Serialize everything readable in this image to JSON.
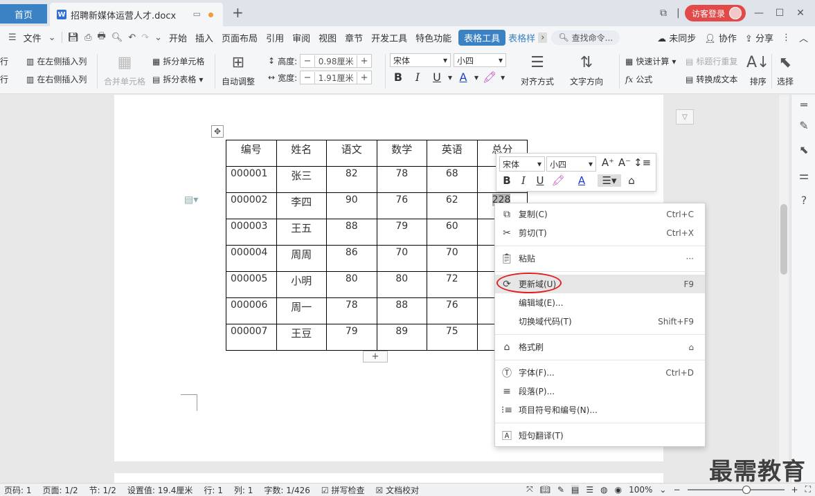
{
  "tabs": {
    "home": "首页",
    "doc_title": "招聘新媒体运营人才.docx",
    "new": "+"
  },
  "titlebar": {
    "login": "访客登录"
  },
  "menu": {
    "file": "文件",
    "items": [
      "开始",
      "插入",
      "页面布局",
      "引用",
      "审阅",
      "视图",
      "章节",
      "开发工具",
      "特色功能"
    ],
    "table_tools": "表格工具",
    "table_style": "表格样",
    "search": "查找命令...",
    "unsync": "未同步",
    "collab": "协作",
    "share": "分享"
  },
  "ribbon": {
    "insert_row_above_partial": "行",
    "insert_row_below_partial": "行",
    "insert_col_left": "在左侧插入列",
    "insert_col_right": "在右侧插入列",
    "merge_cells": "合并单元格",
    "split_cells": "拆分单元格",
    "split_table": "拆分表格",
    "auto_fit": "自动调整",
    "height_label": "高度:",
    "height_value": "0.98厘米",
    "width_label": "宽度:",
    "width_value": "1.91厘米",
    "font_name": "宋体",
    "font_size": "小四",
    "align": "对齐方式",
    "text_dir": "文字方向",
    "quick_calc": "快速计算",
    "repeat_header": "标题行重复",
    "formula": "公式",
    "to_text": "转换成文本",
    "sort": "排序",
    "select": "选择"
  },
  "table": {
    "headers": [
      "编号",
      "姓名",
      "语文",
      "数学",
      "英语",
      "总分"
    ],
    "rows": [
      [
        "000001",
        "张三",
        "82",
        "78",
        "68",
        "2"
      ],
      [
        "000002",
        "李四",
        "90",
        "76",
        "62",
        ""
      ],
      [
        "000003",
        "王五",
        "88",
        "79",
        "60",
        ""
      ],
      [
        "000004",
        "周周",
        "86",
        "70",
        "70",
        ""
      ],
      [
        "000005",
        "小明",
        "80",
        "80",
        "72",
        ""
      ],
      [
        "000006",
        "周一",
        "78",
        "88",
        "76",
        ""
      ],
      [
        "000007",
        "王豆",
        "79",
        "89",
        "75",
        ""
      ]
    ],
    "selected_value": "228",
    "add_row": "+"
  },
  "mini_toolbar": {
    "font": "宋体",
    "size": "小四"
  },
  "context_menu": {
    "copy": "复制(C)",
    "copy_sc": "Ctrl+C",
    "cut": "剪切(T)",
    "cut_sc": "Ctrl+X",
    "paste": "粘贴",
    "paste_more": "···",
    "update_field": "更新域(U)",
    "update_field_sc": "F9",
    "edit_field": "编辑域(E)...",
    "toggle_code": "切换域代码(T)",
    "toggle_code_sc": "Shift+F9",
    "format_painter": "格式刷",
    "font": "字体(F)...",
    "font_sc": "Ctrl+D",
    "paragraph": "段落(P)...",
    "bullets": "项目符号和编号(N)...",
    "translate": "短句翻译(T)"
  },
  "status": {
    "page_num": "页码: 1",
    "pages": "页面: 1/2",
    "section": "节: 1/2",
    "setting": "设置值: 19.4厘米",
    "row": "行: 1",
    "col": "列: 1",
    "words": "字数: 1/426",
    "spell": "拼写检查",
    "proof": "文档校对",
    "zoom": "100%"
  },
  "watermark": "最需教育",
  "colors": {
    "accent": "#3b82c4",
    "login": "#e24a4a",
    "highlight_ring": "#e02020"
  }
}
